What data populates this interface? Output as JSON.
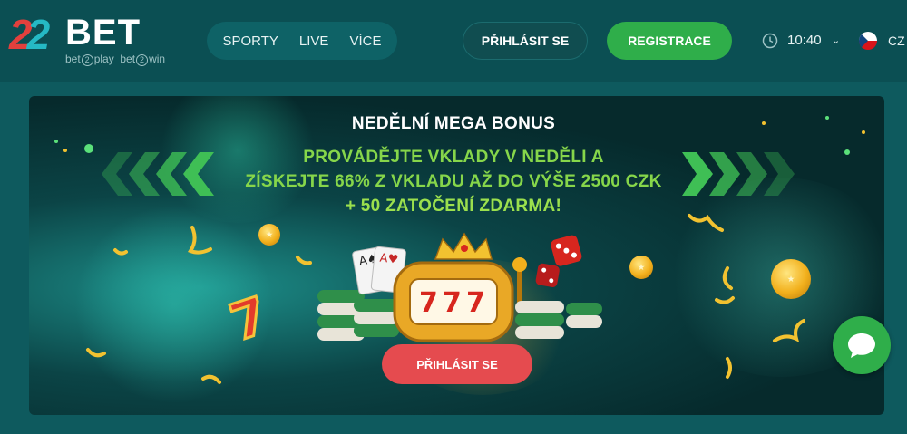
{
  "header": {
    "logo": {
      "digits": "22",
      "word": "BET",
      "tagline": "bet⃝2play  bet⃝2win"
    },
    "nav": [
      {
        "label": "SPORTY"
      },
      {
        "label": "LIVE"
      },
      {
        "label": "VÍCE"
      }
    ],
    "login_label": "PŘIHLÁSIT SE",
    "register_label": "REGISTRACE",
    "time": "10:40",
    "language": "CZ",
    "icons": {
      "clock": "clock-icon",
      "caret": "chevron-down-icon",
      "flag": "czech-flag-icon"
    }
  },
  "banner": {
    "title": "NEDĚLNÍ MEGA BONUS",
    "line1": "PROVÁDĚJTE VKLADY V NEDĚLI A",
    "line2": "ZÍSKEJTE 66% Z VKLADU AŽ DO VÝŠE 2500 CZK",
    "line3": "+ 50 ZATOČENÍ ZDARMA!",
    "cta_label": "PŘIHLÁSIT SE"
  },
  "chat": {
    "icon": "chat-bubble-icon"
  },
  "colors": {
    "header_bg": "#0b4f53",
    "page_bg": "#0e5a5e",
    "register_green": "#2fae4a",
    "cta_red": "#e54b4f",
    "headline_green": "#86d64a"
  }
}
